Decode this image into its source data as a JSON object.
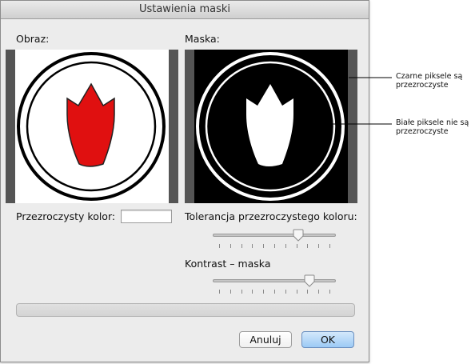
{
  "window": {
    "title": "Ustawienia maski"
  },
  "labels": {
    "image": "Obraz:",
    "mask": "Maska:",
    "transparent_color": "Przezroczysty kolor:",
    "tolerance": "Tolerancja przezroczystego koloru:",
    "contrast": "Kontrast – maska"
  },
  "inputs": {
    "transparent_color_value": ""
  },
  "sliders": {
    "tolerance": {
      "value": 0.72,
      "ticks": 11
    },
    "contrast": {
      "value": 0.82,
      "ticks": 11
    }
  },
  "progress": {
    "value": 0
  },
  "buttons": {
    "cancel": "Anuluj",
    "ok": "OK"
  },
  "annotations": {
    "black_pixels_line1": "Czarne piksele są",
    "black_pixels_line2": "przezroczyste",
    "white_pixels_line1": "Białe piksele nie są",
    "white_pixels_line2": "przezroczyste"
  },
  "colors": {
    "tulip": "#e01010",
    "ok_button": "#9ccaf5",
    "frame": "#555555"
  }
}
